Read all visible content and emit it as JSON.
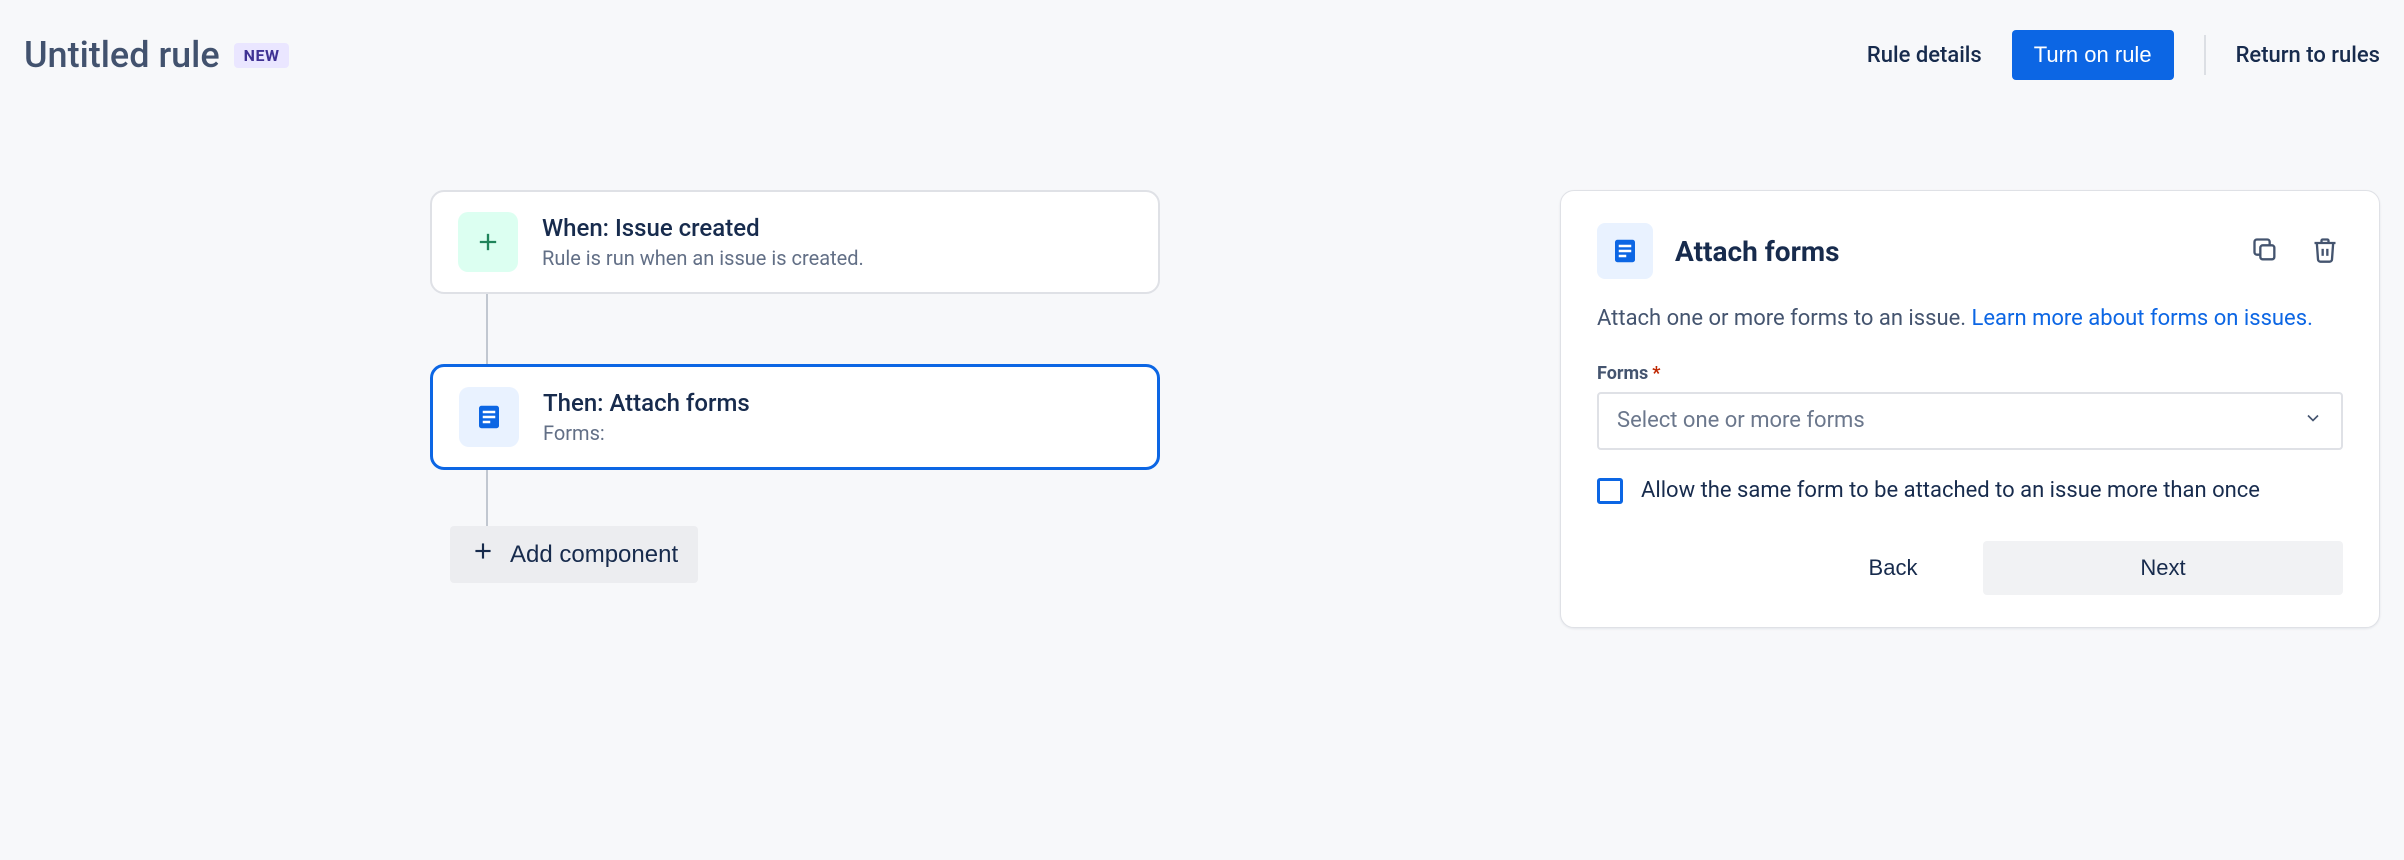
{
  "header": {
    "title": "Untitled rule",
    "badge": "NEW",
    "rule_details": "Rule details",
    "turn_on": "Turn on rule",
    "return": "Return to rules"
  },
  "flow": {
    "trigger": {
      "title": "When: Issue created",
      "sub": "Rule is run when an issue is created."
    },
    "action": {
      "title": "Then: Attach forms",
      "sub": "Forms:"
    },
    "add_component": "Add component"
  },
  "panel": {
    "title": "Attach forms",
    "description_text": "Attach one or more forms to an issue. ",
    "description_link": "Learn more about forms on issues.",
    "forms_label": "Forms",
    "forms_placeholder": "Select one or more forms",
    "checkbox_label": "Allow the same form to be attached to an issue more than once",
    "back": "Back",
    "next": "Next"
  }
}
